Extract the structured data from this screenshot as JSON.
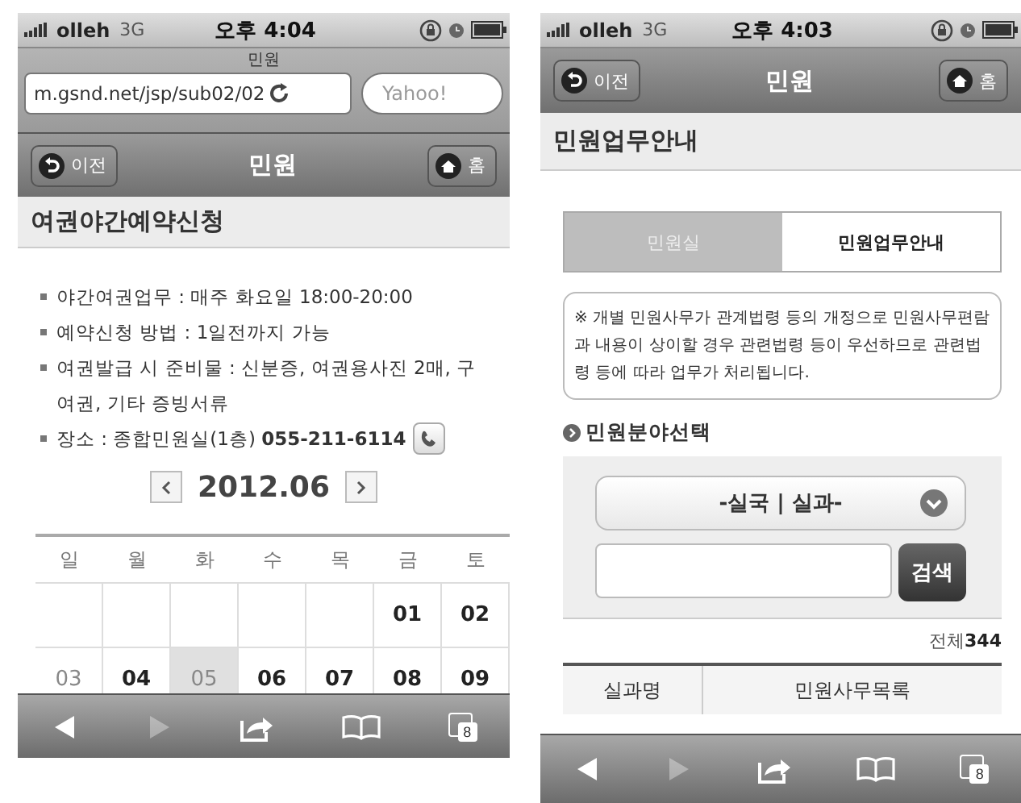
{
  "left_phone": {
    "status_bar": {
      "carrier": "olleh",
      "network": "3G",
      "time": "오후 4:04"
    },
    "browser": {
      "page_title": "민원",
      "url": "m.gsnd.net/jsp/sub02/02",
      "search_placeholder": "Yahoo!"
    },
    "nav_bar": {
      "back_label": "이전",
      "title": "민원",
      "home_label": "홈"
    },
    "page_heading": "여권야간예약신청",
    "info_items": [
      "야간여권업무 : 매주 화요일 18:00-20:00",
      "예약신청 방법 : 1일전까지 가능",
      "여권발급 시 준비물 : 신분증, 여권용사진 2매, 구여권, 기타 증빙서류",
      "장소 : 종합민원실(1층) **055-211-6114**"
    ],
    "calendar": {
      "month": "2012.06",
      "weekdays": [
        "일",
        "월",
        "화",
        "수",
        "목",
        "금",
        "토"
      ],
      "weeks": [
        [
          {
            "kind": "blank"
          },
          {
            "kind": "blank"
          },
          {
            "kind": "blank"
          },
          {
            "kind": "blank"
          },
          {
            "kind": "blank"
          },
          {
            "kind": "day",
            "day": "01",
            "muted": false,
            "selected": false
          },
          {
            "kind": "day",
            "day": "02",
            "muted": false,
            "selected": false
          }
        ],
        [
          {
            "kind": "day",
            "day": "03",
            "muted": true,
            "selected": false
          },
          {
            "kind": "day",
            "day": "04",
            "muted": false,
            "selected": false
          },
          {
            "kind": "day",
            "day": "05",
            "muted": true,
            "selected": true
          },
          {
            "kind": "day",
            "day": "06",
            "muted": false,
            "selected": false
          },
          {
            "kind": "day",
            "day": "07",
            "muted": false,
            "selected": false
          },
          {
            "kind": "day",
            "day": "08",
            "muted": false,
            "selected": false
          },
          {
            "kind": "day",
            "day": "09",
            "muted": false,
            "selected": false
          }
        ]
      ]
    },
    "toolbar": [
      {
        "kind": "back",
        "disabled": false
      },
      {
        "kind": "forward",
        "disabled": true
      },
      {
        "kind": "share",
        "disabled": false
      },
      {
        "kind": "bookmarks",
        "disabled": false
      },
      {
        "kind": "tabs",
        "disabled": false,
        "count": "8"
      }
    ]
  },
  "right_phone": {
    "status_bar": {
      "carrier": "olleh",
      "network": "3G",
      "time": "오후 4:03"
    },
    "nav_bar": {
      "back_label": "이전",
      "title": "민원",
      "home_label": "홈"
    },
    "page_heading": "민원업무안내",
    "tabs": [
      {
        "label": "민원실",
        "selected": false
      },
      {
        "label": "민원업무안내",
        "selected": true
      }
    ],
    "notice": "※ 개별 민원사무가 관계법령 등의 개정으로 민원사무편람과 내용이 상이할 경우 관련법령 등이 우선하므로 관련법령 등에 따라 업무가 처리됩니다.",
    "section_title": "민원분야선택",
    "select_value": "-실국 | 실과-",
    "search_button": "검색",
    "total": "전체**344**",
    "table": {
      "columns": [
        "실과명",
        "민원사무목록"
      ]
    },
    "toolbar": [
      {
        "kind": "back",
        "disabled": false
      },
      {
        "kind": "forward",
        "disabled": true
      },
      {
        "kind": "share",
        "disabled": false
      },
      {
        "kind": "bookmarks",
        "disabled": false
      },
      {
        "kind": "tabs",
        "disabled": false,
        "count": "8"
      }
    ]
  }
}
